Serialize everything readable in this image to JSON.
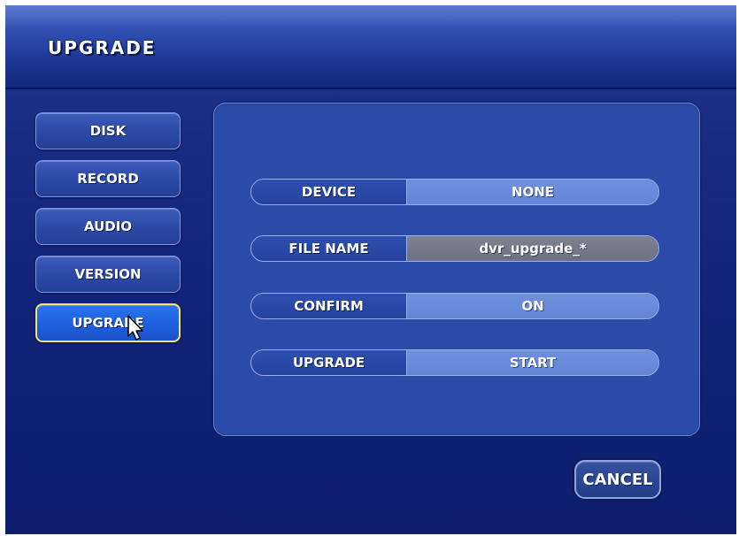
{
  "header": {
    "title": "UPGRADE"
  },
  "sidebar": {
    "items": [
      {
        "label": "DISK"
      },
      {
        "label": "RECORD"
      },
      {
        "label": "AUDIO"
      },
      {
        "label": "VERSION"
      },
      {
        "label": "UPGRADE",
        "selected": true
      }
    ]
  },
  "settings": {
    "rows": [
      {
        "label": "DEVICE",
        "value": "NONE"
      },
      {
        "label": "FILE NAME",
        "value": "dvr_upgrade_*",
        "disabled": true
      },
      {
        "label": "CONFIRM",
        "value": "ON"
      },
      {
        "label": "UPGRADE",
        "value": "START"
      }
    ]
  },
  "footer": {
    "cancel_label": "CANCEL"
  },
  "colors": {
    "header_top": "#5f7bd0",
    "background": "#0d1e6a",
    "panel": "#2b4ba9",
    "value_field": "#6f8fde",
    "disabled_field": "#7d8393",
    "selected_button": "#1e5fde",
    "selected_border": "#f2e56c"
  },
  "cursor": {
    "icon": "mouse-pointer-icon"
  }
}
